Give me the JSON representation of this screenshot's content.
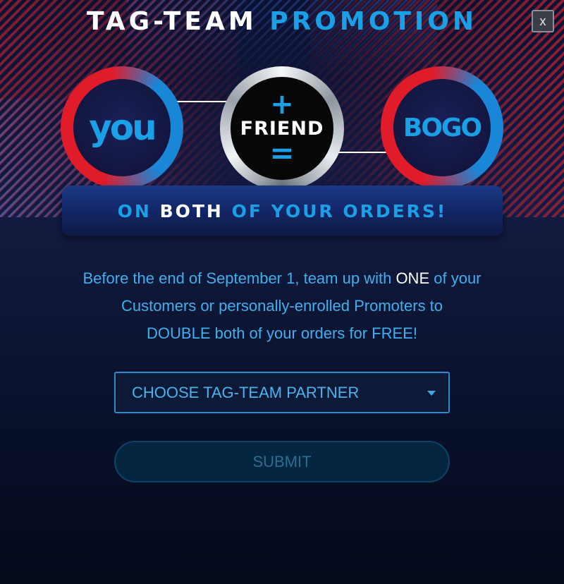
{
  "modal": {
    "title_part1": "TAG-TEAM",
    "title_part2": "PROMOTION",
    "close_label": "x"
  },
  "hero": {
    "left_circle_text": "you",
    "center_plus": "+",
    "center_text": "FRIEND",
    "center_equals": "=",
    "right_circle_text": "BOGO"
  },
  "banner": {
    "part1": "ON",
    "part2": "BOTH",
    "part3": "OF YOUR ORDERS!"
  },
  "description": {
    "seg1": "Before the end of September 1, team up with",
    "highlight": "ONE",
    "seg2": "of your",
    "line2": "Customers or personally-enrolled Promoters to",
    "line3": "DOUBLE both of your orders for FREE!"
  },
  "partner_select": {
    "selected_value": "CHOOSE TAG-TEAM PARTNER"
  },
  "submit": {
    "label": "SUBMIT"
  },
  "colors": {
    "accent_blue": "#1aa0e6",
    "accent_red": "#e11c2a",
    "text_blue": "#3fb0ec",
    "submit_disabled_text": "#2d6d8f"
  },
  "icons": {
    "select_caret": "caret-down-icon",
    "close": "close-icon"
  }
}
